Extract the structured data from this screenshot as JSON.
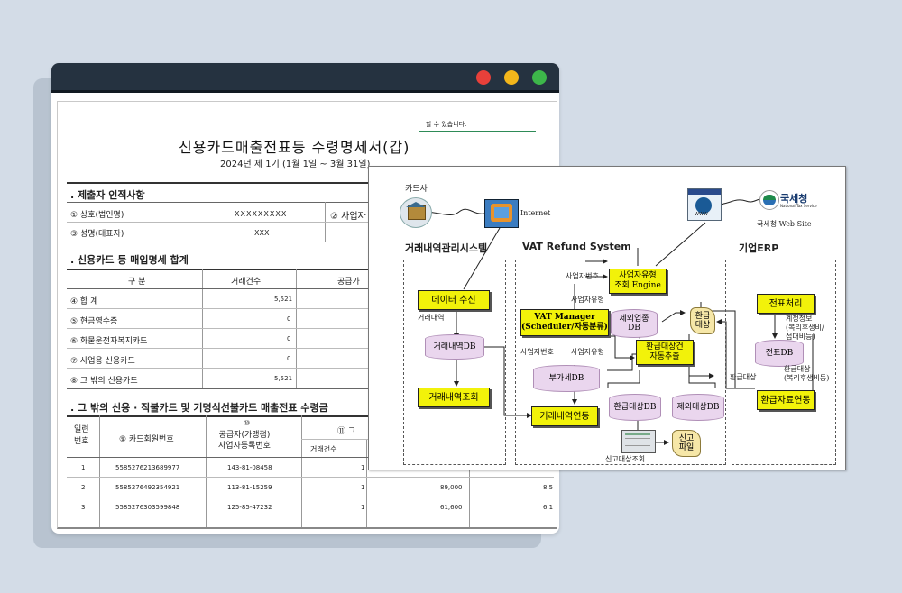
{
  "window": {
    "controls": {
      "close_color": "#e8403a",
      "minimize_color": "#f3b61b",
      "maximize_color": "#3db64a"
    }
  },
  "document": {
    "title": "신용카드매출전표등 수령명세서(갑)",
    "subtitle": "2024년 제 1기 (1월 1일 ~ 3월 31일)",
    "top_note": "할 수 있습니다.",
    "section1": {
      "heading": ". 제출자 인적사항",
      "rows": [
        {
          "label": "① 상호(법인명)",
          "value": "XXXXXXXXX",
          "label2": "② 사업자"
        },
        {
          "label": "③ 성명(대표자)",
          "value": "XXX"
        }
      ]
    },
    "section2": {
      "heading": ". 신용카드 등 매입명세 합계",
      "headers": [
        "구 분",
        "거래건수",
        "공급가"
      ],
      "rows": [
        {
          "label": "④ 합 계",
          "count": "5,521"
        },
        {
          "label": "⑤ 현금영수증",
          "count": "0"
        },
        {
          "label": "⑥ 화물운전자복지카드",
          "count": "0"
        },
        {
          "label": "⑦ 사업용 신용카드",
          "count": "0"
        },
        {
          "label": "⑧ 그 밖의 신용카드",
          "count": "5,521"
        }
      ]
    },
    "section3": {
      "heading": ". 그 밖의 신용 · 직불카드 및 기명식선불카드 매출전표 수령금",
      "col_serial": "일련\n번호",
      "col_card": "⑨ 카드회원번호",
      "col_supplier_no": "⑩",
      "col_supplier": "공급자(가맹점)\n사업자등록번호",
      "col_group": "⑪ 그",
      "col_count": "거래건수",
      "rows": [
        {
          "no": "1",
          "card": "5585276213689977",
          "biz": "143-81-08458",
          "count": "1",
          "amount": "",
          "tail": ""
        },
        {
          "no": "2",
          "card": "5585276492354921",
          "biz": "113-81-15259",
          "count": "1",
          "amount": "89,000",
          "tail": "8,5"
        },
        {
          "no": "3",
          "card": "5585276303599848",
          "biz": "125-85-47232",
          "count": "1",
          "amount": "61,600",
          "tail": "6,1"
        }
      ]
    }
  },
  "diagram": {
    "card_company": "카드사",
    "internet": "Internet",
    "nts_logo": "국세청",
    "nts_logo_sub": "National Tax Service",
    "nts_site": "국세청 Web Site",
    "www": "WWW",
    "groups": {
      "trade": "거래내역관리시스템",
      "vat": "VAT Refund System",
      "erp": "기업ERP"
    },
    "boxes": {
      "data_receive": "데이터 수신",
      "trade_query": "거래내역조회",
      "biz_type_engine": "사업자유형\n조회 Engine",
      "vat_manager": "VAT Manager\n(Scheduler/자동분류)",
      "refund_extract": "환급대상건\n자동추출",
      "trade_link": "거래내역연동",
      "voucher_proc": "전표처리",
      "refund_link": "환급자료연동"
    },
    "dbs": {
      "trade_db": "거래내역DB",
      "exempt_db": "제외업종\nDB",
      "vat_db": "부가세DB",
      "refund_db": "환급대상DB",
      "excluded_db": "제외대상DB",
      "voucher_db": "전표DB"
    },
    "rolls": {
      "refund_target": "환급\n대상",
      "report_file": "신고\n파일"
    },
    "labels": {
      "trade_history": "거래내역",
      "biz_no1": "사업자번호",
      "biz_type1": "사업자유형",
      "biz_no2": "사업자번호",
      "biz_type2": "사업자유형",
      "report_query": "신고대상조회",
      "refund_target": "환급대상",
      "account_info": "계정정보\n(복리후생비/\n접대비등)",
      "refund_info": "환급대상\n(복리후생비등)"
    }
  }
}
